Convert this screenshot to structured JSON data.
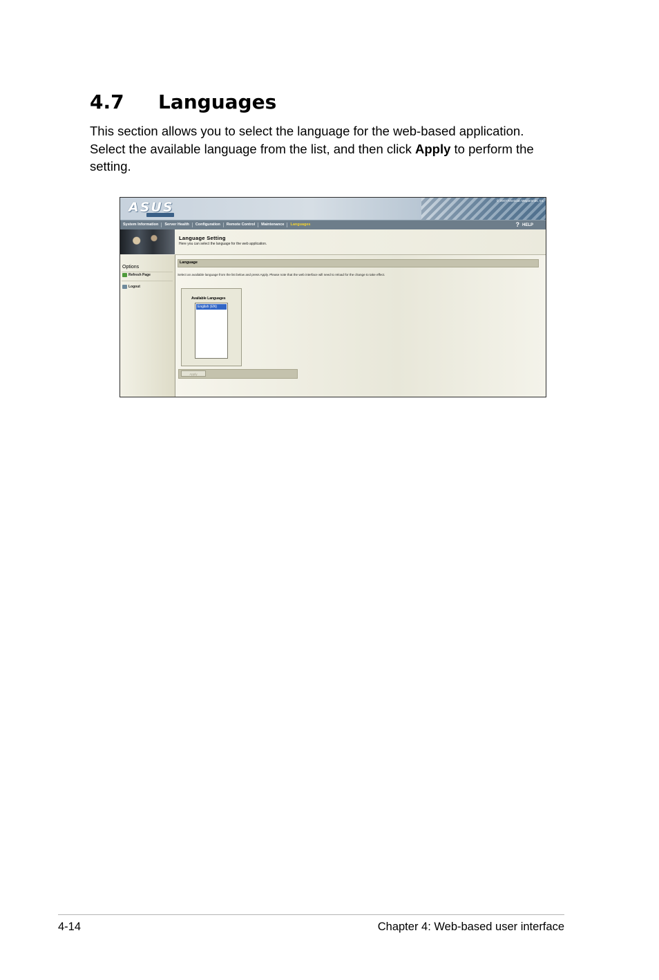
{
  "section": {
    "number": "4.7",
    "title": "Languages"
  },
  "intro": {
    "text_before": "This section allows you to select the language for the web-based application. Select the available language from the list, and then click ",
    "bold": "Apply",
    "text_after": " to perform the setting."
  },
  "screenshot": {
    "logo": "ASUS",
    "copyright": "© 2007 American Megatrends, Inc",
    "nav": [
      "System Information",
      "Server Health",
      "Configuration",
      "Remote Control",
      "Maintenance",
      "Languages"
    ],
    "active_nav": "Languages",
    "help": "HELP",
    "help_icon": "?",
    "page_title": "Language Setting",
    "page_subtitle": "Here you can select the language for the web application.",
    "sidebar": {
      "heading": "Options",
      "items": [
        "Refresh Page",
        "Logout"
      ]
    },
    "section_header": "Language",
    "instruction": "Select an available language from the list below and press Apply. Please note that the web interface will need to reload for the change to take effect.",
    "available_label": "Available Languages",
    "languages": [
      "English (EN)"
    ],
    "apply_button": "Apply",
    "colors": {
      "nav_bg": "#6d7d8a",
      "nav_active": "#f5d430",
      "selected_option": "#3166c6"
    }
  },
  "footer": {
    "page_number": "4-14",
    "chapter": "Chapter 4: Web-based user interface"
  }
}
